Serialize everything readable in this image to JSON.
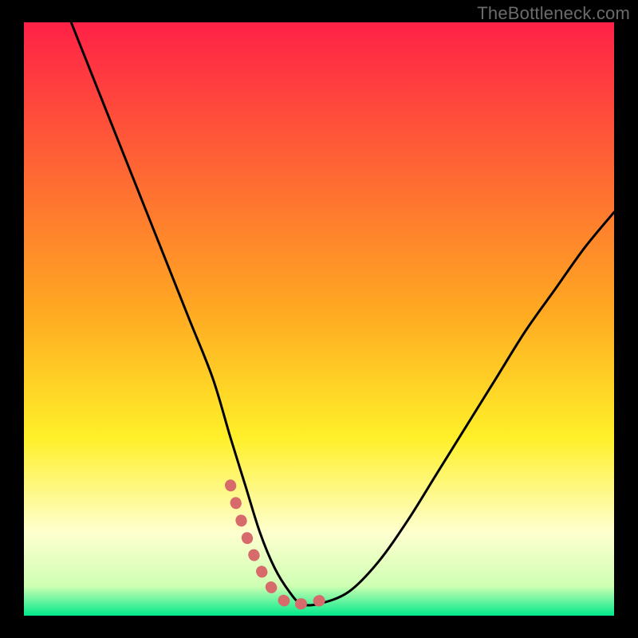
{
  "watermark": "TheBottleneck.com",
  "palette": {
    "red": "#ff2147",
    "yellow": "#fff029",
    "green": "#00e98b",
    "light_yellow": "#feffcf",
    "marker": "#d76b6b",
    "curve": "#000000",
    "frame": "#000000"
  },
  "chart_data": {
    "type": "line",
    "title": "",
    "xlabel": "",
    "ylabel": "",
    "xlim": [
      0,
      100
    ],
    "ylim": [
      0,
      100
    ],
    "series": [
      {
        "name": "bottleneck-curve",
        "x": [
          8,
          12,
          16,
          20,
          24,
          28,
          32,
          35,
          37.5,
          40,
          42.5,
          45,
          47,
          50,
          55,
          60,
          65,
          70,
          75,
          80,
          85,
          90,
          95,
          100
        ],
        "y": [
          100,
          90,
          80,
          70,
          60,
          50,
          40,
          30,
          22,
          14,
          8,
          4,
          2,
          2,
          4,
          9,
          16,
          24,
          32,
          40,
          48,
          55,
          62,
          68
        ]
      }
    ],
    "highlight_segment": {
      "name": "optimal-range",
      "x": [
        35,
        37.5,
        40,
        42.5,
        45,
        47,
        50,
        52.5
      ],
      "y": [
        22,
        14,
        8,
        4,
        2,
        2,
        2.5,
        4
      ]
    },
    "gradient_stops": [
      {
        "offset": 0.0,
        "color": "#ff2147"
      },
      {
        "offset": 0.48,
        "color": "#ffa722"
      },
      {
        "offset": 0.7,
        "color": "#fff029"
      },
      {
        "offset": 0.86,
        "color": "#feffcf"
      },
      {
        "offset": 0.95,
        "color": "#cfffb3"
      },
      {
        "offset": 1.0,
        "color": "#00e98b"
      }
    ]
  }
}
